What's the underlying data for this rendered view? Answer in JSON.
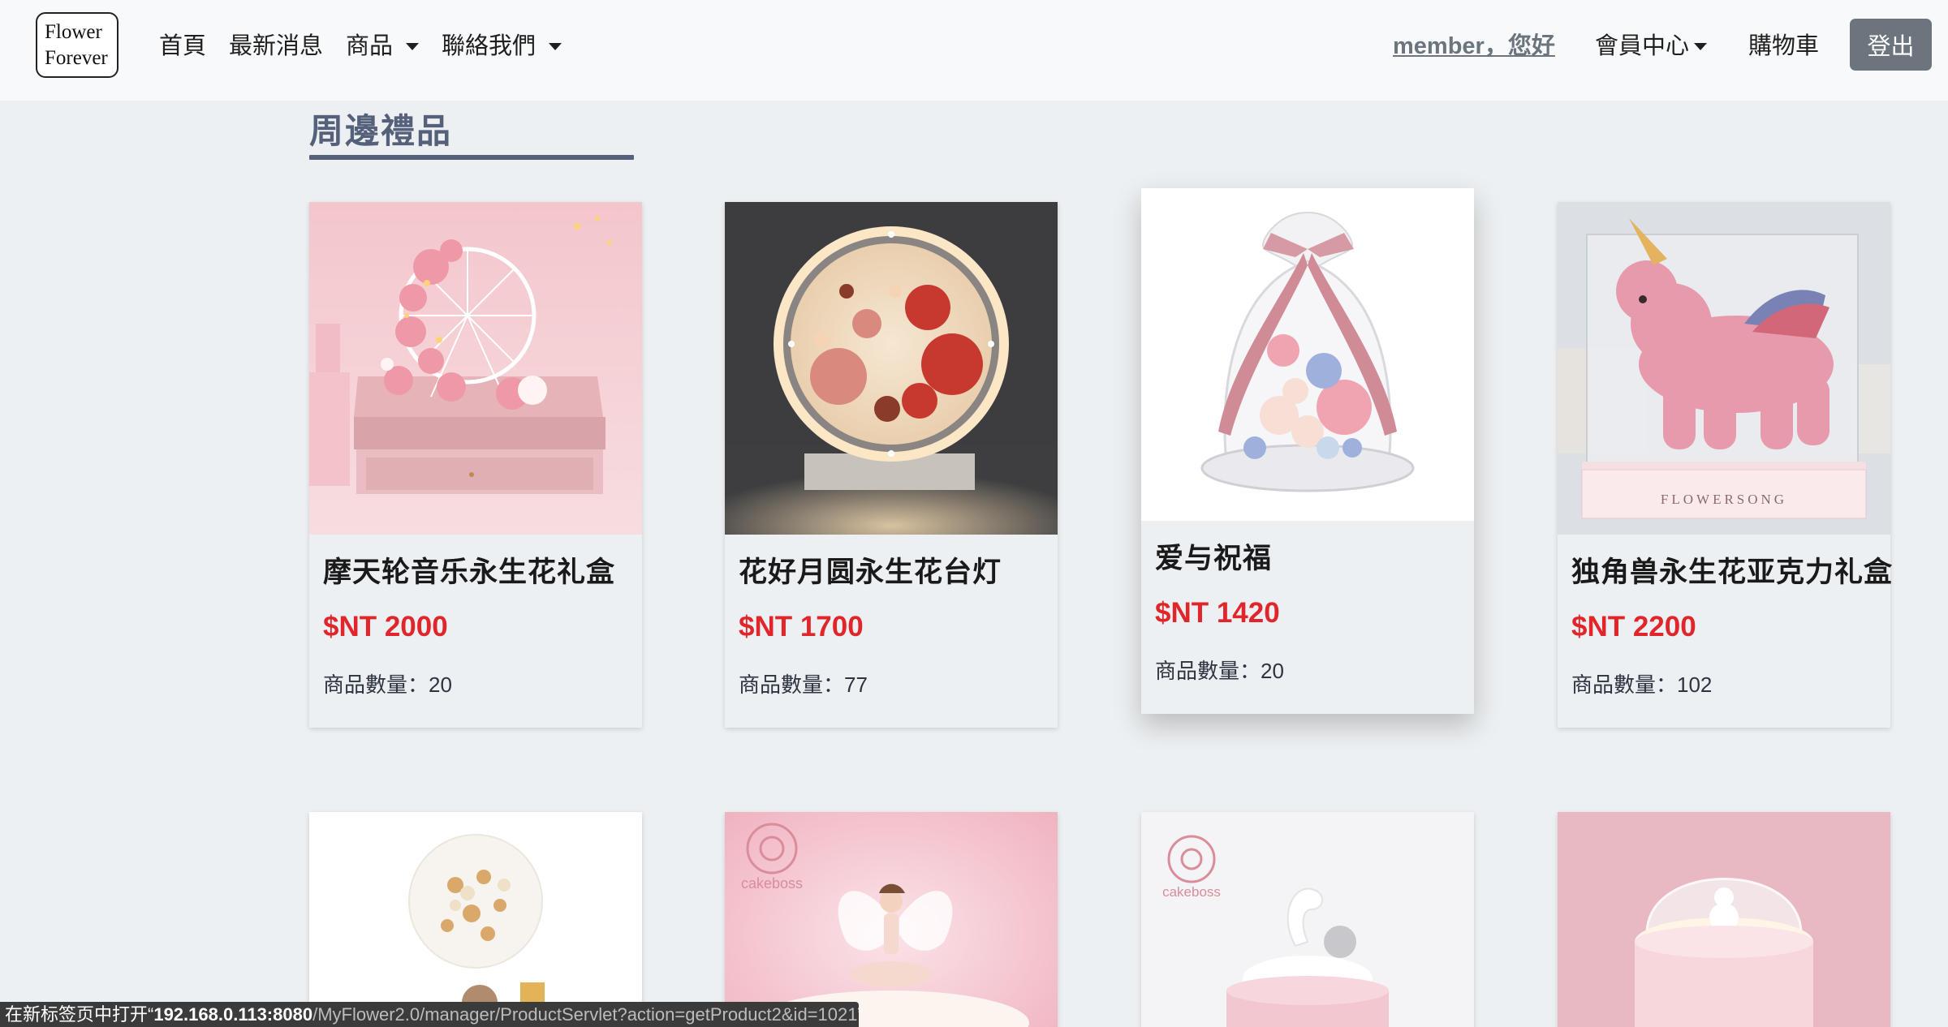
{
  "brand": {
    "line1": "Flower",
    "line2": "Forever"
  },
  "nav": {
    "home": "首頁",
    "news": "最新消息",
    "products": "商品",
    "contact": "聯絡我們",
    "greeting": "member，您好",
    "member_center": "會員中心",
    "cart": "購物車",
    "logout": "登出"
  },
  "section": {
    "title": "周邊禮品"
  },
  "qty_label": "商品數量：",
  "products": [
    {
      "name": "摩天轮音乐永生花礼盒",
      "price": "$NT 2000",
      "qty": "20"
    },
    {
      "name": "花好月圆永生花台灯",
      "price": "$NT 1700",
      "qty": "77"
    },
    {
      "name": "爱与祝福",
      "price": "$NT 1420",
      "qty": "20"
    },
    {
      "name": "独角兽永生花亚克力礼盒",
      "price": "$NT 2200",
      "qty": "102"
    }
  ],
  "image_text": {
    "flowersong": "FLOWERSONG",
    "cakeboss1": "cakeboss",
    "cakeboss2": "cakeboss"
  },
  "status": {
    "prefix": "在新标签页中打开“",
    "host": "192.168.0.113:8080",
    "path": "/MyFlower2.0/manager/ProductServlet?action=getProduct2&id=1021",
    "suffix": "”"
  },
  "colors": {
    "price": "#e0262b",
    "heading": "#55607a",
    "logout": "#6c757d"
  }
}
